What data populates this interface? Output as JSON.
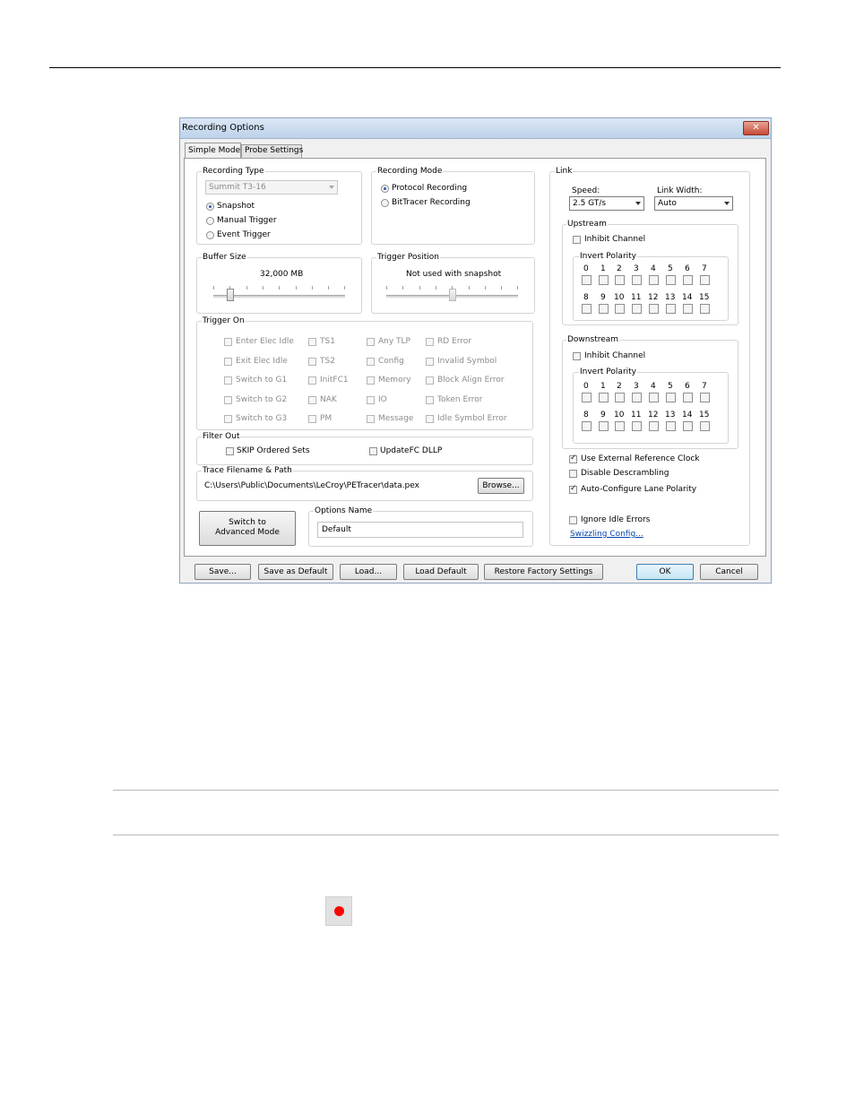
{
  "window": {
    "title": "Recording Options",
    "close_glyph": "✕"
  },
  "tabs": [
    {
      "label": "Simple Mode",
      "active": true
    },
    {
      "label": "Probe Settings",
      "active": false
    }
  ],
  "recording_type": {
    "label": "Recording Type",
    "device": "Summit T3-16",
    "options": [
      "Snapshot",
      "Manual Trigger",
      "Event Trigger"
    ],
    "selected": "Snapshot"
  },
  "recording_mode": {
    "label": "Recording Mode",
    "options": [
      "Protocol Recording",
      "BitTracer Recording"
    ],
    "selected": "Protocol Recording"
  },
  "buffer_size": {
    "label": "Buffer Size",
    "value": "32,000 MB",
    "slider_fraction": 0.13
  },
  "trigger_position": {
    "label": "Trigger Position",
    "note": "Not used with snapshot",
    "slider_fraction": 0.5
  },
  "trigger_on": {
    "label": "Trigger On",
    "col1": [
      "Enter Elec Idle",
      "Exit Elec Idle",
      "Switch to G1",
      "Switch to G2",
      "Switch to G3"
    ],
    "col2": [
      "TS1",
      "TS2",
      "InitFC1",
      "NAK",
      "PM"
    ],
    "col3": [
      "Any TLP",
      "Config",
      "Memory",
      "IO",
      "Message"
    ],
    "col4": [
      "RD Error",
      "Invalid Symbol",
      "Block Align Error",
      "Token Error",
      "Idle Symbol Error"
    ]
  },
  "filter_out": {
    "label": "Filter Out",
    "skip": "SKIP Ordered Sets",
    "updatefc": "UpdateFC DLLP"
  },
  "trace": {
    "label": "Trace Filename & Path",
    "path": "C:\\Users\\Public\\Documents\\LeCroy\\PETracer\\data.pex",
    "browse": "Browse..."
  },
  "advanced_button": {
    "line1": "Switch to",
    "line2": "Advanced Mode"
  },
  "options_name": {
    "label": "Options Name",
    "value": "Default"
  },
  "link": {
    "label": "Link",
    "speed_label": "Speed:",
    "speed_value": "2.5 GT/s",
    "width_label": "Link Width:",
    "width_value": "Auto",
    "upstream": {
      "label": "Upstream",
      "inhibit": "Inhibit Channel",
      "polarity_label": "Invert Polarity"
    },
    "downstream": {
      "label": "Downstream",
      "inhibit": "Inhibit Channel",
      "polarity_label": "Invert Polarity"
    },
    "lanes_row1": [
      "0",
      "1",
      "2",
      "3",
      "4",
      "5",
      "6",
      "7"
    ],
    "lanes_row2": [
      "8",
      "9",
      "10",
      "11",
      "12",
      "13",
      "14",
      "15"
    ],
    "use_external_clock": "Use External Reference Clock",
    "disable_descrambling": "Disable Descrambling",
    "auto_configure": "Auto-Configure Lane Polarity",
    "ignore_idle": "Ignore Idle Errors",
    "swizzling": "Swizzling Config..."
  },
  "footer_buttons": {
    "save": "Save...",
    "save_default": "Save as Default",
    "load": "Load...",
    "load_default": "Load Default",
    "restore": "Restore Factory Settings",
    "ok": "OK",
    "cancel": "Cancel"
  },
  "record_icon": "record-icon"
}
